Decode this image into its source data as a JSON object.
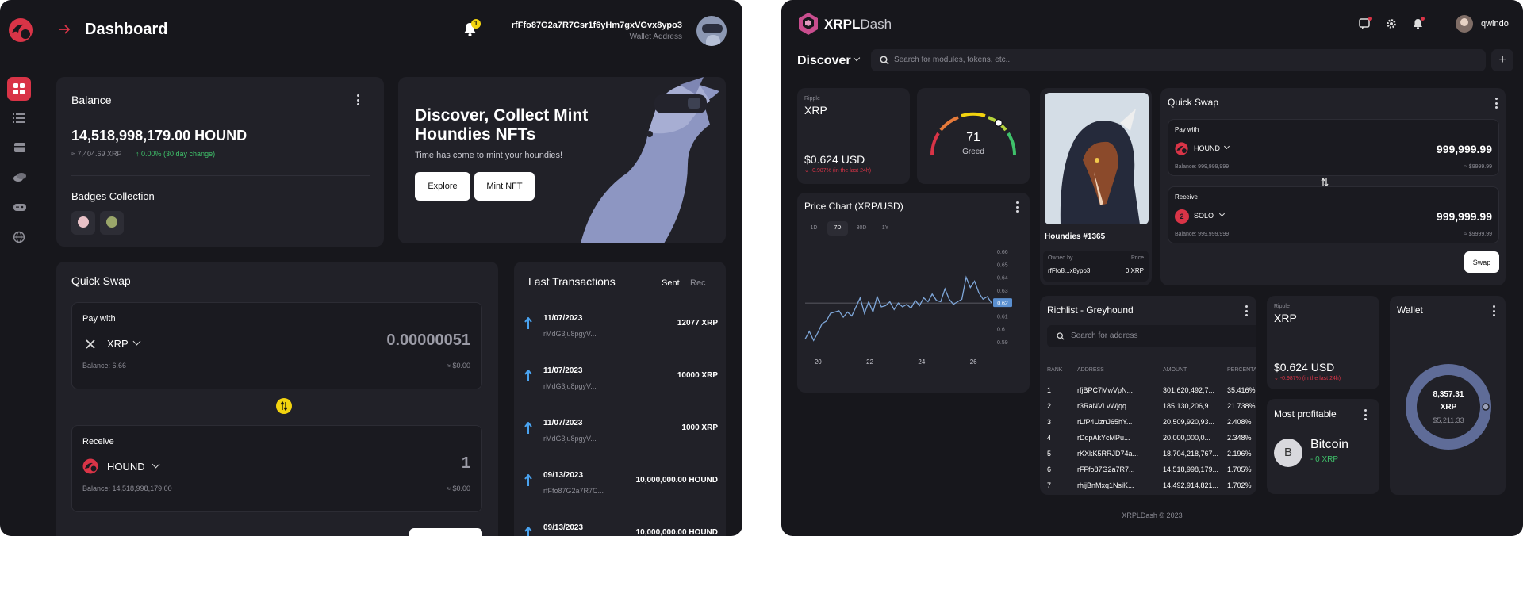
{
  "left": {
    "header": {
      "title": "Dashboard",
      "notification_count": "1",
      "wallet_address": "rfFfo87G2a7R7Csr1f6yHm7gxVGvx8ypo3",
      "wallet_label": "Wallet Address"
    },
    "balance": {
      "title": "Balance",
      "amount": "14,518,998,179.00 HOUND",
      "xrp_equiv": "≈ 7,404.69 XRP",
      "change": "0.00% (30 day change)",
      "badges_title": "Badges Collection"
    },
    "promo": {
      "title": "Discover, Collect Mint Houndies NFTs",
      "subtitle": "Time has come to mint your houndies!",
      "explore_label": "Explore",
      "mint_label": "Mint NFT"
    },
    "quick_swap": {
      "title": "Quick Swap",
      "pay_label": "Pay with",
      "pay_token": "XRP",
      "pay_amount": "0.00000051",
      "pay_balance": "Balance: 6.66",
      "pay_usd": "≈ $0.00",
      "receive_label": "Receive",
      "receive_token": "HOUND",
      "receive_amount": "1",
      "receive_balance": "Balance: 14,518,998,179.00",
      "receive_usd": "≈ $0.00"
    },
    "transactions": {
      "title": "Last Transactions",
      "tab_sent": "Sent",
      "tab_received": "Rec",
      "items": [
        {
          "date": "11/07/2023",
          "addr": "rMdG3ju8pgyV...",
          "amount": "12077 XRP"
        },
        {
          "date": "11/07/2023",
          "addr": "rMdG3ju8pgyV...",
          "amount": "10000 XRP"
        },
        {
          "date": "11/07/2023",
          "addr": "rMdG3ju8pgyV...",
          "amount": "1000 XRP"
        },
        {
          "date": "09/13/2023",
          "addr": "rfFfo87G2a7R7C...",
          "amount": "10,000,000.00 HOUND"
        },
        {
          "date": "09/13/2023",
          "addr": "",
          "amount": "10,000,000.00 HOUND"
        }
      ]
    }
  },
  "right": {
    "header": {
      "brand_a": "XRPL",
      "brand_b": "Dash",
      "username": "qwindo"
    },
    "discover": {
      "label": "Discover",
      "search_placeholder": "Search for modules, tokens, etc...",
      "add_label": "+"
    },
    "xrp_card": {
      "issuer": "Ripple",
      "symbol": "XRP",
      "price": "$0.624 USD",
      "change": "-0.987% (in the last 24h)"
    },
    "fear_greed": {
      "value": "71",
      "label": "Greed",
      "gauge_fraction": 0.71
    },
    "price_chart": {
      "title": "Price Chart (XRP/USD)",
      "ranges": [
        "1D",
        "7D",
        "30D",
        "1Y"
      ],
      "active_range": "7D",
      "current_tag": "0.62"
    },
    "nft": {
      "name": "Houndies #1365",
      "owner_label": "Owned by",
      "owner": "rfFfo8...x8ypo3",
      "price_label": "Price",
      "price": "0 XRP"
    },
    "quick_swap": {
      "title": "Quick Swap",
      "pay_label": "Pay with",
      "pay_token": "HOUND",
      "pay_amount": "999,999.99",
      "pay_balance": "Balance: 999,999,999",
      "pay_usd": "≈ $9999.99",
      "receive_label": "Receive",
      "receive_token": "SOLO",
      "receive_amount": "999,999.99",
      "receive_balance": "Balance: 999,999,999",
      "receive_usd": "≈ $9999.99",
      "swap_label": "Swap"
    },
    "richlist": {
      "title": "Richlist - Greyhound",
      "search_placeholder": "Search for address",
      "columns": [
        "RANK",
        "ADDRESS",
        "AMOUNT",
        "PERCENTAGE"
      ],
      "rows": [
        [
          "1",
          "rfjBPC7MwVpN...",
          "301,620,492,7...",
          "35.416%"
        ],
        [
          "2",
          "r3RaNVLvWjqq...",
          "185,130,206,9...",
          "21.738%"
        ],
        [
          "3",
          "rLfP4UznJ65hY...",
          "20,509,920,93...",
          "2.408%"
        ],
        [
          "4",
          "rDdpAkYcMPu...",
          "20,000,000,0...",
          "2.348%"
        ],
        [
          "5",
          "rKXkK5RRJD74a...",
          "18,704,218,767...",
          "2.196%"
        ],
        [
          "6",
          "rFFfo87G2a7R7...",
          "14,518,998,179...",
          "1.705%"
        ],
        [
          "7",
          "rhijBnMxq1NsiK...",
          "14,492,914,821...",
          "1.702%"
        ]
      ]
    },
    "xrp_card2": {
      "issuer": "Ripple",
      "symbol": "XRP",
      "price": "$0.624 USD",
      "change": "-0.987% (in the last 24h)"
    },
    "most_profitable": {
      "title": "Most profitable",
      "coin_letter": "B",
      "coin_name": "Bitcoin",
      "coin_change": "0 XRP"
    },
    "wallet": {
      "title": "Wallet",
      "amount": "8,357.31",
      "symbol": "XRP",
      "usd": "$5,211.33"
    },
    "footer": "XRPLDash © 2023"
  },
  "chart_data": {
    "type": "line",
    "title": "Price Chart (XRP/USD)",
    "xlabel": "",
    "ylabel": "",
    "x_ticks": [
      "20",
      "22",
      "24",
      "26"
    ],
    "y_ticks": [
      "0.66",
      "0.65",
      "0.64",
      "0.63",
      "0.62",
      "0.61",
      "0.6",
      "0.59"
    ],
    "ylim": [
      0.585,
      0.665
    ],
    "series": [
      {
        "values": [
          0.592,
          0.598,
          0.591,
          0.597,
          0.604,
          0.606,
          0.612,
          0.613,
          0.614,
          0.609,
          0.613,
          0.61,
          0.617,
          0.624,
          0.612,
          0.621,
          0.613,
          0.625,
          0.617,
          0.618,
          0.621,
          0.615,
          0.62,
          0.617,
          0.619,
          0.616,
          0.622,
          0.618,
          0.624,
          0.621,
          0.627,
          0.622,
          0.621,
          0.631,
          0.623,
          0.619,
          0.621,
          0.623,
          0.64,
          0.632,
          0.637,
          0.628,
          0.623,
          0.625,
          0.62
        ]
      }
    ]
  },
  "colors": {
    "accent_red": "#d93447",
    "green": "#3fc16a",
    "yellow": "#f2d30f",
    "blue_arrow": "#4aa3f0"
  }
}
